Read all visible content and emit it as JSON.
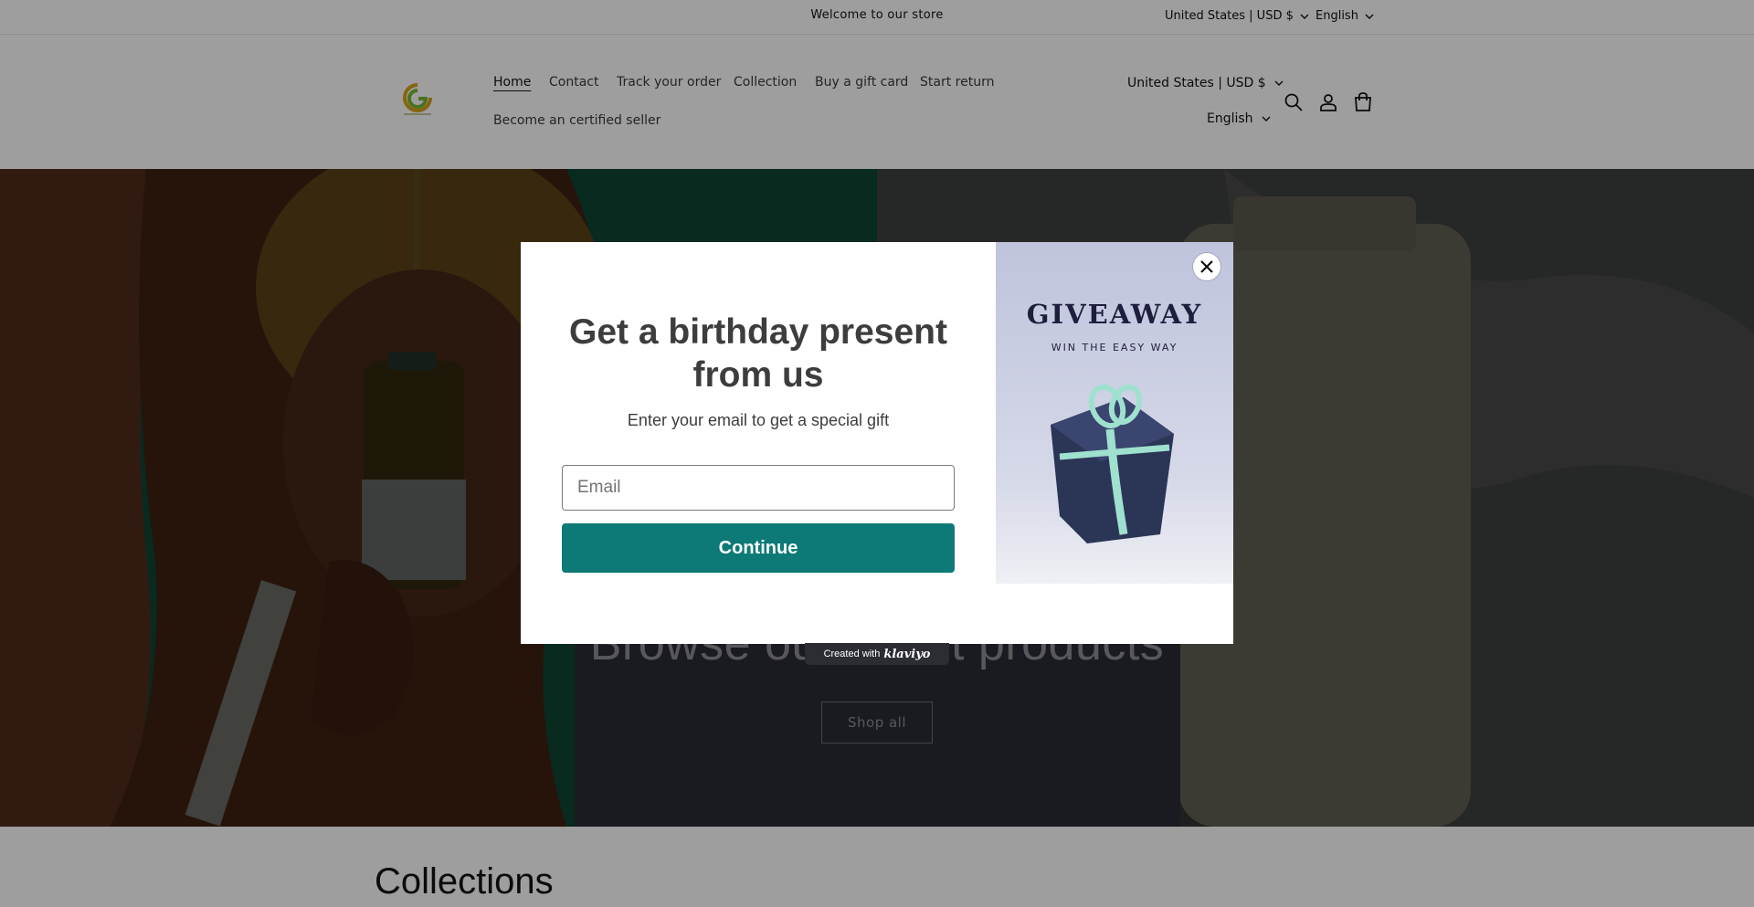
{
  "announcement": {
    "text": "Welcome to our store"
  },
  "top_bar": {
    "country": "United States | USD $",
    "language": "English"
  },
  "header": {
    "logo_name": "store-logo",
    "nav": [
      "Home",
      "Contact",
      "Track your order",
      "Collection",
      "Buy a gift card",
      "Start return",
      "Become an certified seller"
    ],
    "country": "United States | USD $",
    "language": "English",
    "icons": [
      "search-icon",
      "account-icon",
      "cart-icon"
    ]
  },
  "hero": {
    "heading": "Browse our latest products",
    "button": "Shop all"
  },
  "collections": {
    "title": "Collections"
  },
  "popup": {
    "title_line1": "Get a birthday present",
    "title_line2": "from us",
    "subtitle": "Enter your email to get a special gift",
    "email_placeholder": "Email",
    "continue_label": "Continue",
    "image_title": "GIVEAWAY",
    "image_subtitle": "WIN THE EASY WAY",
    "close_icon": "close-icon",
    "brand_color": "#0d7a77"
  },
  "klaviyo_badge": {
    "prefix": "Created with",
    "brand": "klaviyo"
  }
}
